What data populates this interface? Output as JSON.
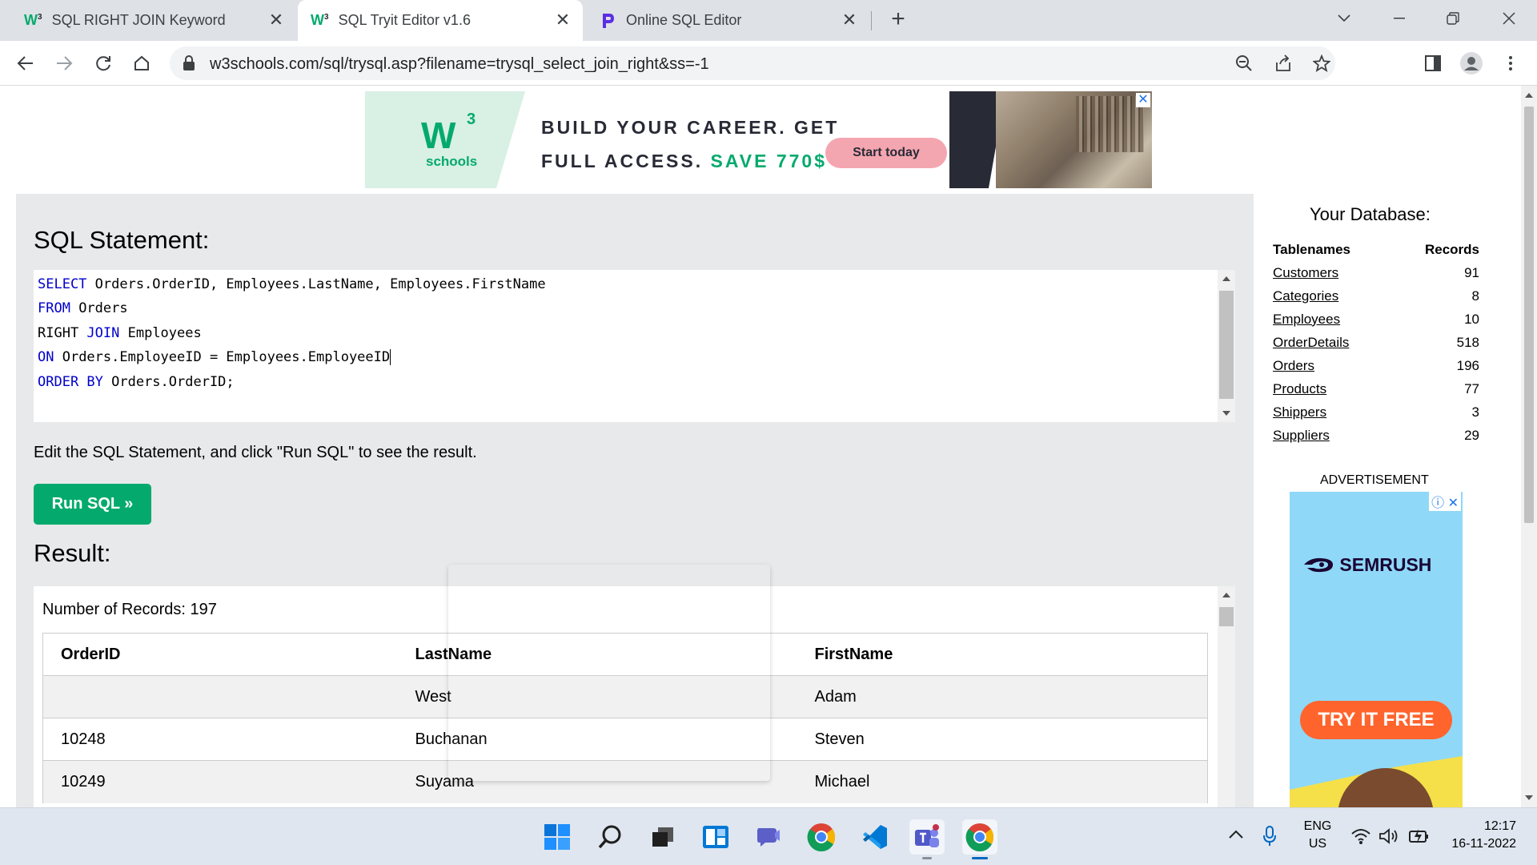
{
  "browser": {
    "tabs": [
      {
        "label": "SQL RIGHT JOIN Keyword",
        "favicon": "w3schools-icon",
        "active": false
      },
      {
        "label": "SQL Tryit Editor v1.6",
        "favicon": "w3schools-icon",
        "active": true
      },
      {
        "label": "Online SQL Editor",
        "favicon": "programiz-icon",
        "active": false
      }
    ],
    "url": "w3schools.com/sql/trysql.asp?filename=trysql_select_join_right&ss=-1"
  },
  "top_ad": {
    "logo_text": "W",
    "logo_sup": "3",
    "logo_sub": "schools",
    "line1": "BUILD YOUR CAREER. GET",
    "line2_prefix": "FULL ACCESS.",
    "line2_highlight": "SAVE 770$",
    "button_label": "Start today",
    "close": "✕"
  },
  "editor": {
    "heading": "SQL Statement:",
    "code_lines": [
      {
        "kw": "SELECT",
        "rest": " Orders.OrderID, Employees.LastName, Employees.FirstName"
      },
      {
        "kw": "FROM",
        "rest": " Orders"
      },
      {
        "pre": "RIGHT ",
        "kw": "JOIN",
        "rest": " Employees"
      },
      {
        "kw": "ON",
        "rest": " Orders.EmployeeID = Employees.EmployeeID"
      },
      {
        "kw": "ORDER BY",
        "rest": " Orders.OrderID;"
      }
    ],
    "instruction": "Edit the SQL Statement, and click \"Run SQL\" to see the result.",
    "run_button": "Run SQL »"
  },
  "result": {
    "heading": "Result:",
    "record_count": "Number of Records: 197",
    "columns": [
      "OrderID",
      "LastName",
      "FirstName"
    ],
    "rows": [
      [
        "",
        "West",
        "Adam"
      ],
      [
        "10248",
        "Buchanan",
        "Steven"
      ],
      [
        "10249",
        "Suyama",
        "Michael"
      ]
    ]
  },
  "database": {
    "title": "Your Database:",
    "col_name": "Tablenames",
    "col_records": "Records",
    "tables": [
      {
        "name": "Customers",
        "records": "91"
      },
      {
        "name": "Categories",
        "records": "8"
      },
      {
        "name": "Employees",
        "records": "10"
      },
      {
        "name": "OrderDetails",
        "records": "518"
      },
      {
        "name": "Orders",
        "records": "196"
      },
      {
        "name": "Products",
        "records": "77"
      },
      {
        "name": "Shippers",
        "records": "3"
      },
      {
        "name": "Suppliers",
        "records": "29"
      }
    ]
  },
  "side_ad": {
    "label": "ADVERTISEMENT",
    "brand": "SEMRUSH",
    "cta": "TRY IT FREE",
    "close": "ⓘ ✕"
  },
  "taskbar": {
    "lang_line1": "ENG",
    "lang_line2": "US",
    "time": "12:17",
    "date": "16-11-2022"
  },
  "colors": {
    "w3_green": "#04aa6d",
    "keyword_blue": "#0000cd",
    "panel_gray": "#e7e9eb",
    "semrush_orange": "#ff642d"
  }
}
